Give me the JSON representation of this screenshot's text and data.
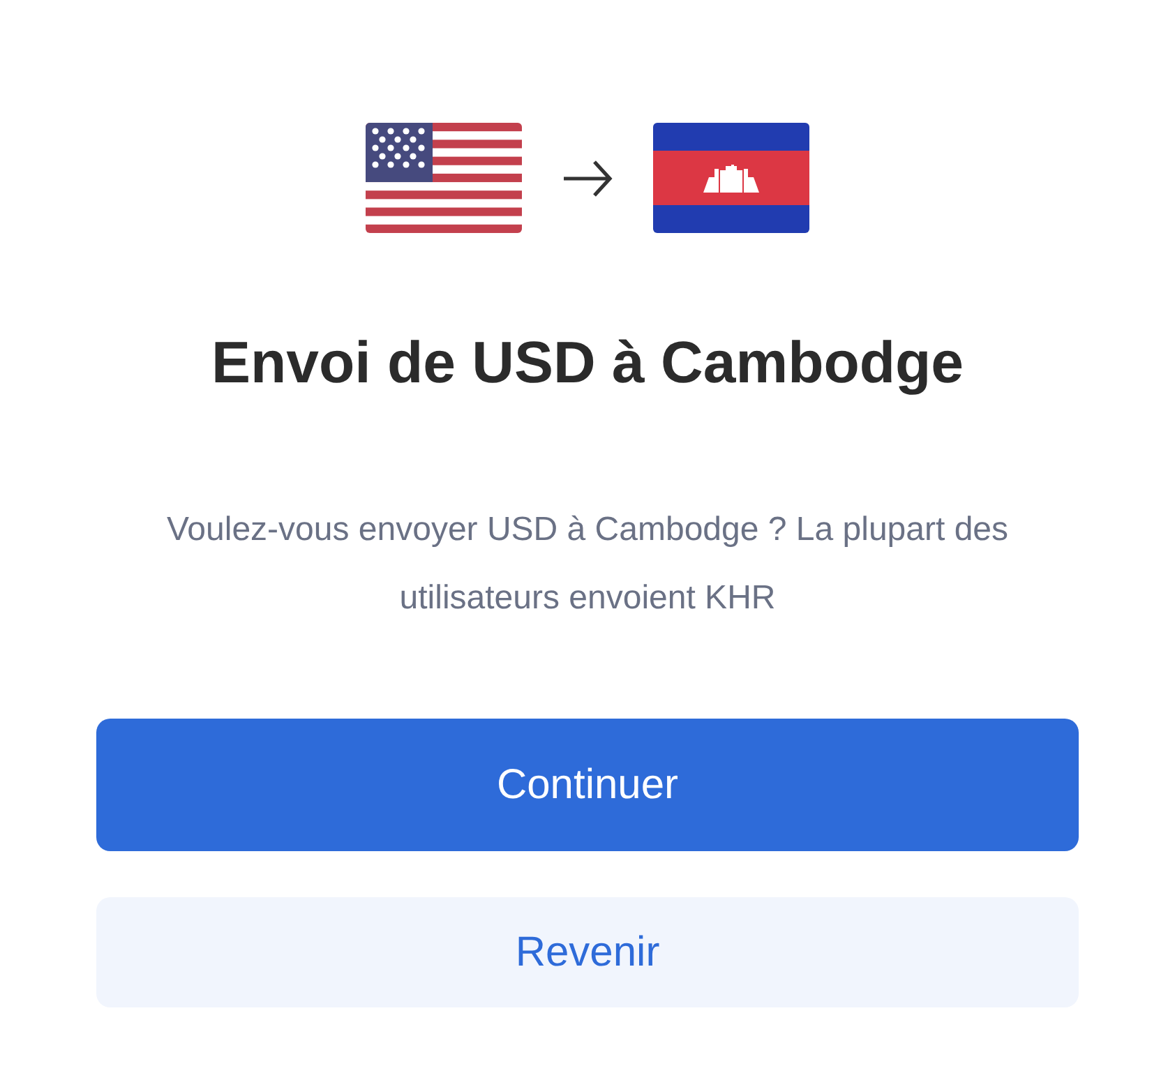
{
  "title": "Envoi de USD à Cambodge",
  "message": "Voulez-vous envoyer USD à Cambodge ? La plupart des utilisateurs envoient KHR",
  "buttons": [
    {
      "label": "Continuer",
      "kind": "primary"
    },
    {
      "label": "Revenir",
      "kind": "secondary"
    }
  ]
}
